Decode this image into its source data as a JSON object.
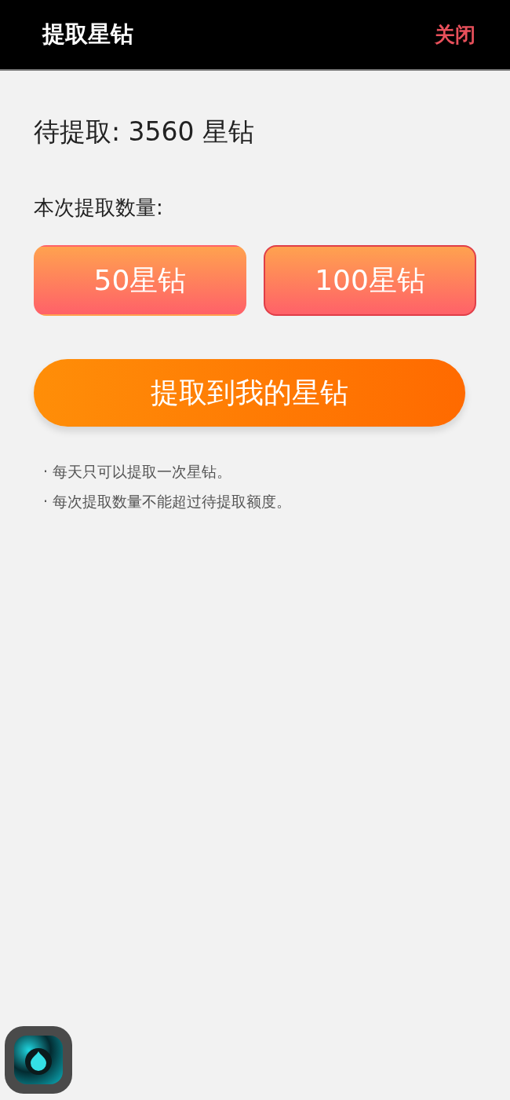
{
  "header": {
    "title": "提取星钻",
    "close": "关闭"
  },
  "pending": "待提取: 3560 星钻",
  "amount_label": "本次提取数量:",
  "options": [
    {
      "label": "50星钻",
      "selected": false
    },
    {
      "label": "100星钻",
      "selected": true
    }
  ],
  "submit": "提取到我的星钻",
  "notes": [
    "· 每天只可以提取一次星钻。",
    "· 每次提取数量不能超过待提取额度。"
  ]
}
